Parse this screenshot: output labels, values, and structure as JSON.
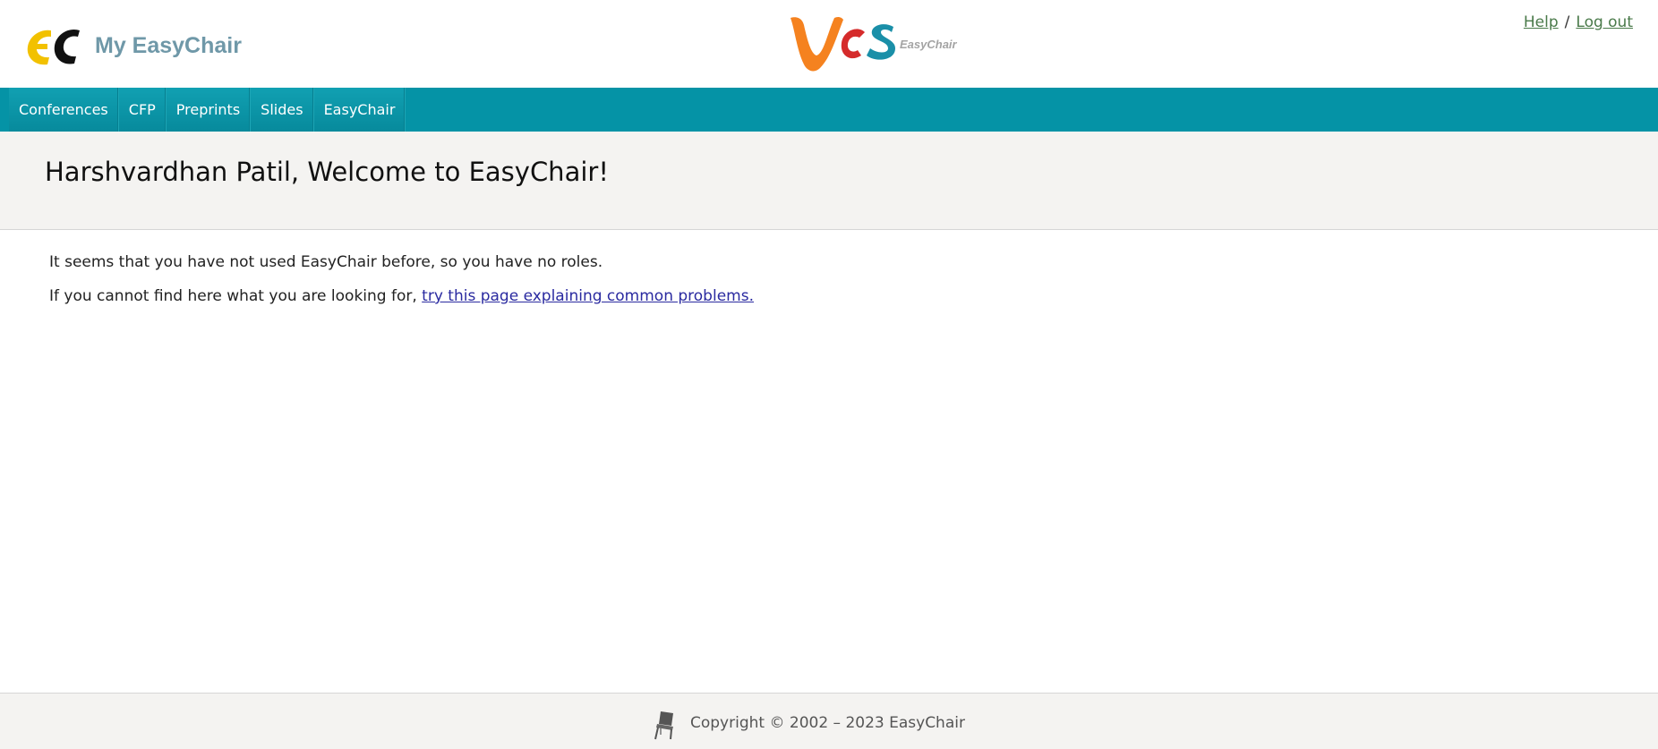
{
  "header": {
    "site_title": "My EasyChair",
    "partner_logo_caption": "EasyChair",
    "links": {
      "help": "Help",
      "separator": "/",
      "logout": "Log out"
    },
    "colors": {
      "brand_yellow": "#f2c100",
      "title_color": "#6f98a8",
      "vcs_orange": "#f5821f",
      "vcs_red": "#d52b2b",
      "vcs_teal": "#1a8fa8"
    }
  },
  "nav": {
    "background": "#0593a6",
    "items": [
      "Conferences",
      "CFP",
      "Preprints",
      "Slides",
      "EasyChair"
    ]
  },
  "main": {
    "page_title": "Harshvardhan Patil, Welcome to EasyChair!",
    "message": "It seems that you have not used EasyChair before, so you have no roles.",
    "help_prefix": "If you cannot find here what you are looking for, ",
    "help_link": "try this page explaining common problems."
  },
  "footer": {
    "copyright": "Copyright © 2002 – 2023 EasyChair",
    "icon": "chair-icon"
  }
}
